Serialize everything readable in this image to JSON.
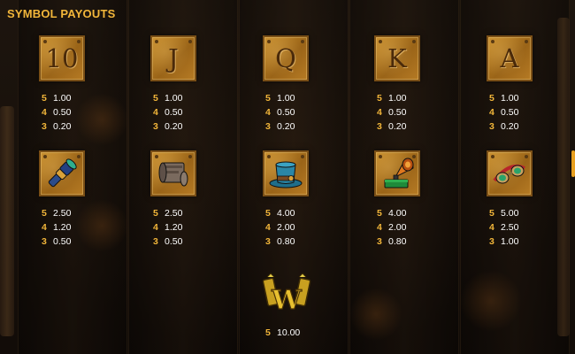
{
  "title": "SYMBOL PAYOUTS",
  "colors": {
    "accent": "#f2b63a",
    "value_text": "#ffffff",
    "background": "#150f0a"
  },
  "symbols": [
    {
      "name": "10",
      "icon": "letter-10-tile",
      "payouts": [
        {
          "count": "5",
          "amount": "1.00"
        },
        {
          "count": "4",
          "amount": "0.50"
        },
        {
          "count": "3",
          "amount": "0.20"
        }
      ]
    },
    {
      "name": "J",
      "icon": "letter-j-tile",
      "payouts": [
        {
          "count": "5",
          "amount": "1.00"
        },
        {
          "count": "4",
          "amount": "0.50"
        },
        {
          "count": "3",
          "amount": "0.20"
        }
      ]
    },
    {
      "name": "Q",
      "icon": "letter-q-tile",
      "payouts": [
        {
          "count": "5",
          "amount": "1.00"
        },
        {
          "count": "4",
          "amount": "0.50"
        },
        {
          "count": "3",
          "amount": "0.20"
        }
      ]
    },
    {
      "name": "K",
      "icon": "letter-k-tile",
      "payouts": [
        {
          "count": "5",
          "amount": "1.00"
        },
        {
          "count": "4",
          "amount": "0.50"
        },
        {
          "count": "3",
          "amount": "0.20"
        }
      ]
    },
    {
      "name": "A",
      "icon": "letter-a-tile",
      "payouts": [
        {
          "count": "5",
          "amount": "1.00"
        },
        {
          "count": "4",
          "amount": "0.50"
        },
        {
          "count": "3",
          "amount": "0.20"
        }
      ]
    },
    {
      "icon": "spyglass-icon",
      "payouts": [
        {
          "count": "5",
          "amount": "2.50"
        },
        {
          "count": "4",
          "amount": "1.20"
        },
        {
          "count": "3",
          "amount": "0.50"
        }
      ]
    },
    {
      "icon": "scroll-icon",
      "payouts": [
        {
          "count": "5",
          "amount": "2.50"
        },
        {
          "count": "4",
          "amount": "1.20"
        },
        {
          "count": "3",
          "amount": "0.50"
        }
      ]
    },
    {
      "icon": "top-hat-icon",
      "payouts": [
        {
          "count": "5",
          "amount": "4.00"
        },
        {
          "count": "4",
          "amount": "2.00"
        },
        {
          "count": "3",
          "amount": "0.80"
        }
      ]
    },
    {
      "icon": "gramophone-icon",
      "payouts": [
        {
          "count": "5",
          "amount": "4.00"
        },
        {
          "count": "4",
          "amount": "2.00"
        },
        {
          "count": "3",
          "amount": "0.80"
        }
      ]
    },
    {
      "icon": "goggles-icon",
      "payouts": [
        {
          "count": "5",
          "amount": "5.00"
        },
        {
          "count": "4",
          "amount": "2.50"
        },
        {
          "count": "3",
          "amount": "1.00"
        }
      ]
    }
  ],
  "wild": {
    "icon": "wild-w-icon",
    "letter": "W",
    "payouts": [
      {
        "count": "5",
        "amount": "10.00"
      }
    ]
  }
}
